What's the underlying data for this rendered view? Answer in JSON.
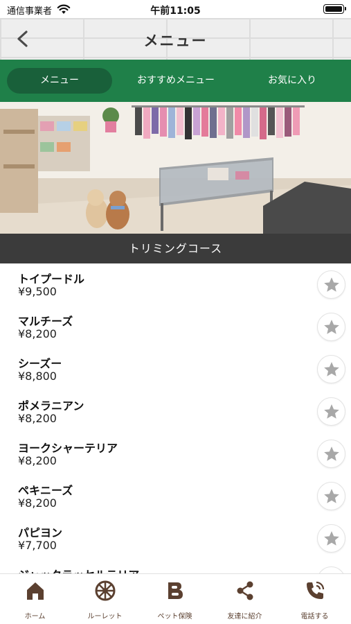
{
  "status_bar": {
    "carrier": "通信事業者",
    "time": "午前11:05"
  },
  "header": {
    "title": "メニュー",
    "back_icon": "chevron-left-icon"
  },
  "tabs": [
    {
      "label": "メニュー",
      "active": true
    },
    {
      "label": "おすすめメニュー",
      "active": false
    },
    {
      "label": "お気に入り",
      "active": false
    }
  ],
  "hero": {
    "description_icon": "shop-photo"
  },
  "section": {
    "title": "トリミングコース"
  },
  "menu_items": [
    {
      "name": "トイプードル",
      "price": "¥9,500"
    },
    {
      "name": "マルチーズ",
      "price": "¥8,200"
    },
    {
      "name": "シーズー",
      "price": "¥8,800"
    },
    {
      "name": "ポメラニアン",
      "price": "¥8,200"
    },
    {
      "name": "ヨークシャーテリア",
      "price": "¥8,200"
    },
    {
      "name": "ペキニーズ",
      "price": "¥8,200"
    },
    {
      "name": "パピヨン",
      "price": "¥7,700"
    },
    {
      "name": "ジャックラッセルテリア",
      "price": ""
    }
  ],
  "bottom_nav": [
    {
      "label": "ホーム",
      "icon": "home-icon"
    },
    {
      "label": "ルーレット",
      "icon": "roulette-icon"
    },
    {
      "label": "ペット保険",
      "icon": "blog-icon"
    },
    {
      "label": "友達に紹介",
      "icon": "share-icon"
    },
    {
      "label": "電話する",
      "icon": "phone-icon"
    }
  ],
  "colors": {
    "tab_bar": "#1f8049",
    "tab_active": "#19603a",
    "section_bar": "#3b3b3b",
    "nav_icon": "#5b4030",
    "star": "#a8a8a8"
  }
}
